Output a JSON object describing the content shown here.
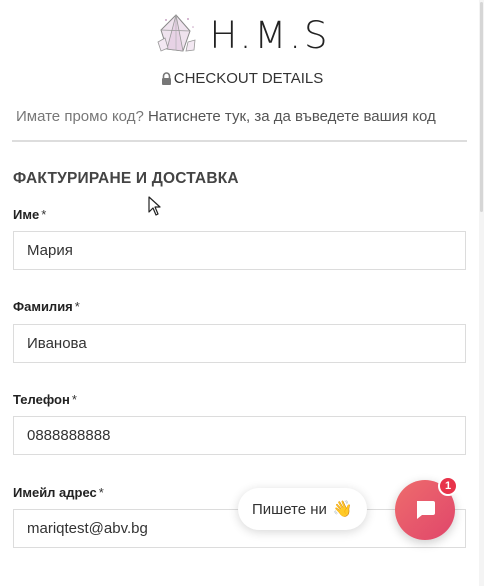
{
  "brand": {
    "logo_text": "H.M.S",
    "logo_icon": "crystal-gem-icon"
  },
  "header": {
    "title": "CHECKOUT DETAILS",
    "icon": "lock-icon"
  },
  "promo": {
    "question": "Имате промо код?",
    "link": "Натиснете тук, за да въведете вашия код"
  },
  "billing": {
    "section_title": "ФАКТУРИРАНЕ И ДОСТАВКА",
    "fields": [
      {
        "label": "Име",
        "required_mark": "*",
        "value": "Мария"
      },
      {
        "label": "Фамилия",
        "required_mark": "*",
        "value": "Иванова"
      },
      {
        "label": "Телефон",
        "required_mark": "*",
        "value": "0888888888"
      },
      {
        "label": "Имейл адрес",
        "required_mark": "*",
        "value": "mariqtest@abv.bg"
      }
    ]
  },
  "chat": {
    "prompt": "Пишете ни",
    "emoji": "👋",
    "badge_count": "1",
    "icon": "chat-icon"
  },
  "colors": {
    "accent_gradient_start": "#ee6c6c",
    "accent_gradient_end": "#e0466b",
    "badge": "#e8334a"
  }
}
